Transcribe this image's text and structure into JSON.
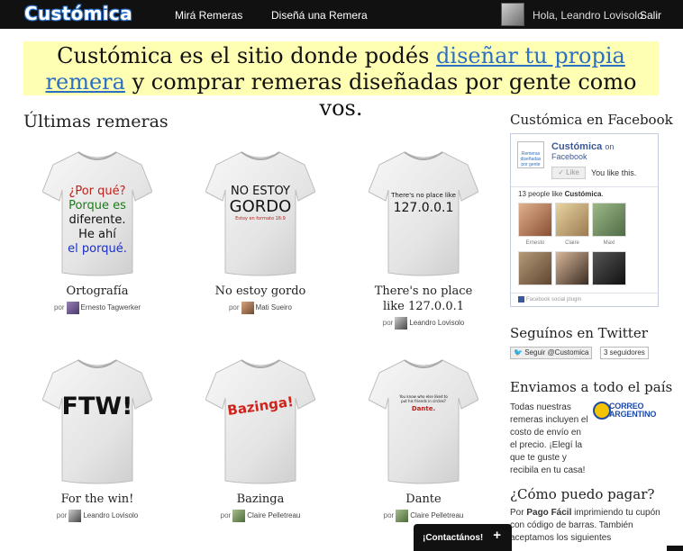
{
  "nav": {
    "logo": "Custómica",
    "links": [
      "Mirá Remeras",
      "Diseñá una Remera"
    ],
    "greeting": "Hola, Leandro Lovisolo",
    "logout": "Salir"
  },
  "hero": {
    "text_before": "Custómica es el sitio donde podés ",
    "link": "diseñar tu propia remera",
    "text_after": " y comprar remeras diseñadas por gente como vos."
  },
  "main": {
    "title": "Últimas remeras",
    "by_label": "por",
    "shirts": [
      {
        "title": "Ortografía",
        "author": "Ernesto Tagwerker",
        "print_lines": [
          "¿Por qué?",
          "Porque es",
          "diferente.",
          "He ahí",
          "el porqué."
        ]
      },
      {
        "title": "No estoy gordo",
        "author": "Mati Sueiro",
        "print_lines": [
          "NO ESTOY",
          "GORDO",
          "Estoy en formato 16:9"
        ]
      },
      {
        "title": "There's no place like 127.0.0.1",
        "author": "Leandro Lovisolo",
        "print_lines": [
          "There's no place like",
          "127.0.0.1"
        ]
      },
      {
        "title": "For the win!",
        "author": "Leandro Lovisolo",
        "print_lines": [
          "FTW!"
        ]
      },
      {
        "title": "Bazinga",
        "author": "Claire Pelletreau",
        "print_lines": [
          "Bazinga!"
        ]
      },
      {
        "title": "Dante",
        "author": "Claire Pelletreau",
        "print_lines": [
          "You know who else liked to",
          "put his friends in circles?",
          "Dante."
        ]
      }
    ]
  },
  "sidebar": {
    "facebook": {
      "title": "Custómica en Facebook",
      "page_name": "Custómica",
      "on_label": "on",
      "sub": "Facebook",
      "logo_text": "Remeras diseñadas por gente",
      "like_button": "Like",
      "you_like": "You like this.",
      "count_text": "13 people like",
      "count_name": "Custómica",
      "faces": [
        "Ernesto",
        "Claire",
        "Maxi",
        "",
        "",
        ""
      ],
      "plugin": "Facebook social plugin"
    },
    "twitter": {
      "title": "Seguínos en Twitter",
      "follow": "Seguir @Customica",
      "followers": "3 seguidores"
    },
    "shipping": {
      "title": "Enviamos a todo el país",
      "text": "Todas nuestras remeras incluyen el costo de envío en el precio. ¡Elegí la que te guste y recibila en tu casa!",
      "logo_line1": "CORREO",
      "logo_line2": "ARGENTINO"
    },
    "payment": {
      "title": "¿Cómo puedo pagar?",
      "text_prefix": "Por ",
      "method": "Pago Fácil",
      "text_rest": " imprimiendo tu cupón con código de barras. También aceptamos los siguientes"
    }
  },
  "contact_tab": {
    "label": "¡Contactános!",
    "icon": "+"
  },
  "colors": {
    "topbar": "#111111",
    "hero_bg": "#ffffb3",
    "link": "#2a6fc4",
    "facebook": "#3b5998"
  }
}
